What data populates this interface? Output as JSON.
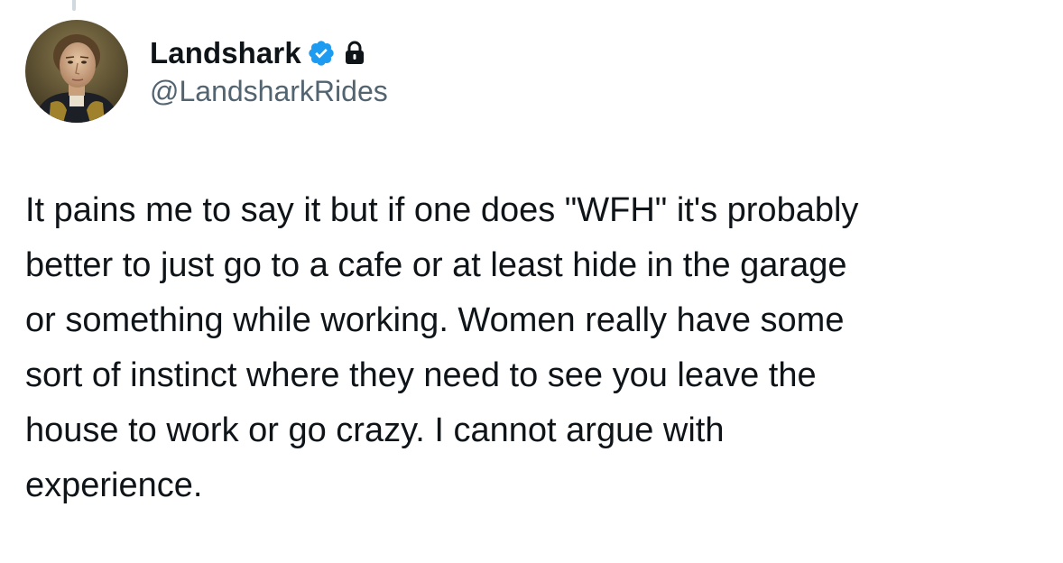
{
  "author": {
    "display_name": "Landshark",
    "handle": "@LandsharkRides",
    "verified": true,
    "protected": true,
    "avatar_icon": "profile-portrait",
    "badge_color": "#1d9bf0"
  },
  "tweet": {
    "text": "It pains me to say it but if one does \"WFH\" it's probably\nbetter to just go to a cafe or at least hide in the garage\nor something while working. Women really have some\nsort of instinct where they need to see you leave the\nhouse to work or go crazy. I cannot argue with\nexperience."
  },
  "colors": {
    "text_primary": "#0f1419",
    "text_secondary": "#536471",
    "thread_line": "#cfd9de"
  }
}
